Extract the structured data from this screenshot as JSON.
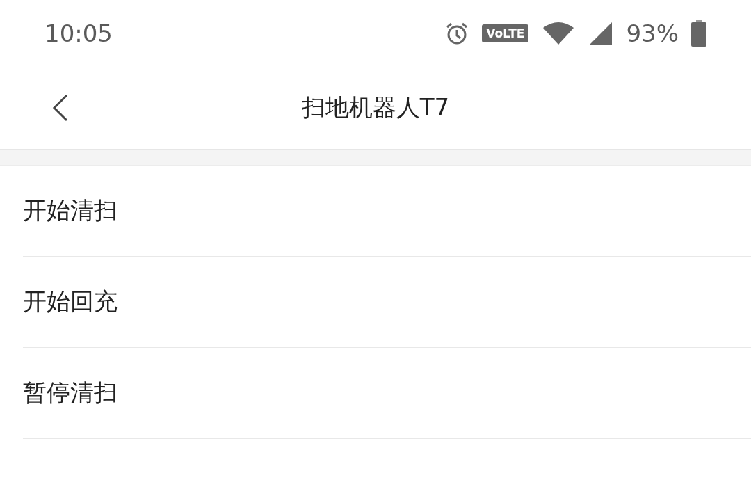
{
  "status_bar": {
    "time": "10:05",
    "volte": "VoLTE",
    "battery": "93%"
  },
  "header": {
    "title": "扫地机器人T7"
  },
  "actions": [
    {
      "label": "开始清扫"
    },
    {
      "label": "开始回充"
    },
    {
      "label": "暂停清扫"
    }
  ]
}
